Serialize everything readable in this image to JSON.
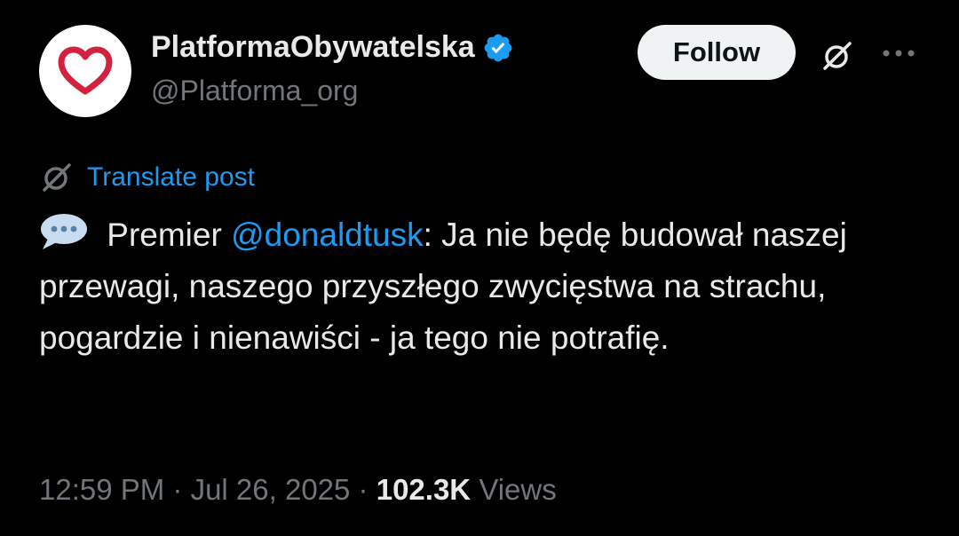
{
  "author": {
    "name": "PlatformaObywatelska",
    "handle": "@Platforma_org",
    "verified": true,
    "avatar_icon": "heart-logo-icon"
  },
  "actions": {
    "follow_label": "Follow",
    "grok_icon": "grok-icon",
    "more_icon": "more-icon"
  },
  "translate": {
    "label": "Translate post",
    "icon": "grok-icon"
  },
  "post": {
    "emoji_icon": "speech-balloon-icon",
    "prefix": " Premier ",
    "mention": "@donaldtusk",
    "body": ": Ja nie będę budował naszej przewagi, naszego przyszłego zwycięstwa na strachu, pogardzie i nienawiści - ja tego nie potrafię."
  },
  "meta": {
    "time": "12:59 PM",
    "date": "Jul 26, 2025",
    "separator": " · ",
    "views_count": "102.3K",
    "views_label": "Views"
  },
  "colors": {
    "background": "#000000",
    "text": "#e7e9ea",
    "secondary": "#71767b",
    "accent": "#1d9bf0",
    "logo_red": "#d4213d"
  }
}
